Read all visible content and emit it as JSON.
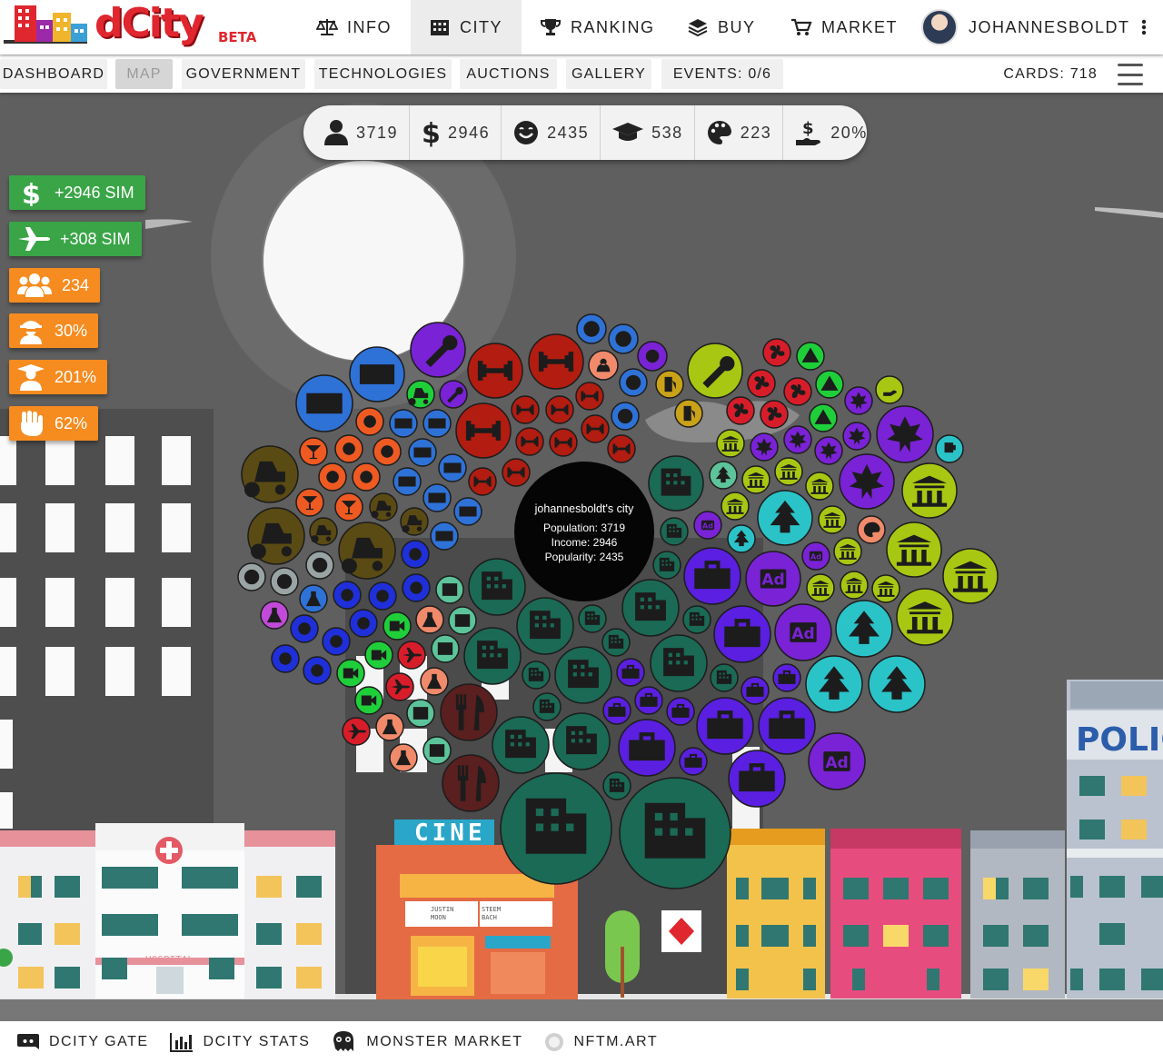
{
  "brand": {
    "logo_text": "dCity",
    "beta": "BETA"
  },
  "nav": {
    "info": "INFO",
    "city": "CITY",
    "ranking": "RANKING",
    "buy": "BUY",
    "market": "MARKET",
    "user": "JOHANNESBOLDT"
  },
  "subnav": {
    "dashboard": "DASHBOARD",
    "map": "MAP",
    "government": "GOVERNMENT",
    "technologies": "TECHNOLOGIES",
    "auctions": "AUCTIONS",
    "gallery": "GALLERY",
    "events": "EVENTS: 0/6",
    "cards": "CARDS: 718"
  },
  "stats": {
    "population": "3719",
    "income": "2946",
    "popularity": "2435",
    "education": "538",
    "creativity": "223",
    "tax": "20%"
  },
  "badges": {
    "income_sim": "+2946 SIM",
    "tourism_sim": "+308 SIM",
    "unemployed": "234",
    "crime": "30%",
    "education": "201%",
    "happiness": "62%"
  },
  "city_center": {
    "title": "johannesboldt's city",
    "population": "Population: 3719",
    "income": "Income: 2946",
    "popularity": "Popularity: 2435"
  },
  "scene_text": {
    "police": "POLIC",
    "cinema": "CINE",
    "hospital": "HOSPITAL",
    "poster1": "JUSTIN MOON",
    "poster2": "STEEM BACH",
    "ad": "Ad"
  },
  "footer": {
    "gate": "DCITY GATE",
    "stats": "DCITY STATS",
    "monster": "MONSTER MARKET",
    "nftm": "NFTM.ART"
  },
  "colors": {
    "accent_red": "#e0262e",
    "green_badge": "#3aa547",
    "orange_badge": "#f68b1f",
    "bubble_dark_teal": "#1a6a55",
    "bubble_purple": "#7a22d6",
    "bubble_blue": "#2e72d8",
    "bubble_red": "#b31c10",
    "bubble_lime": "#a8c712"
  }
}
